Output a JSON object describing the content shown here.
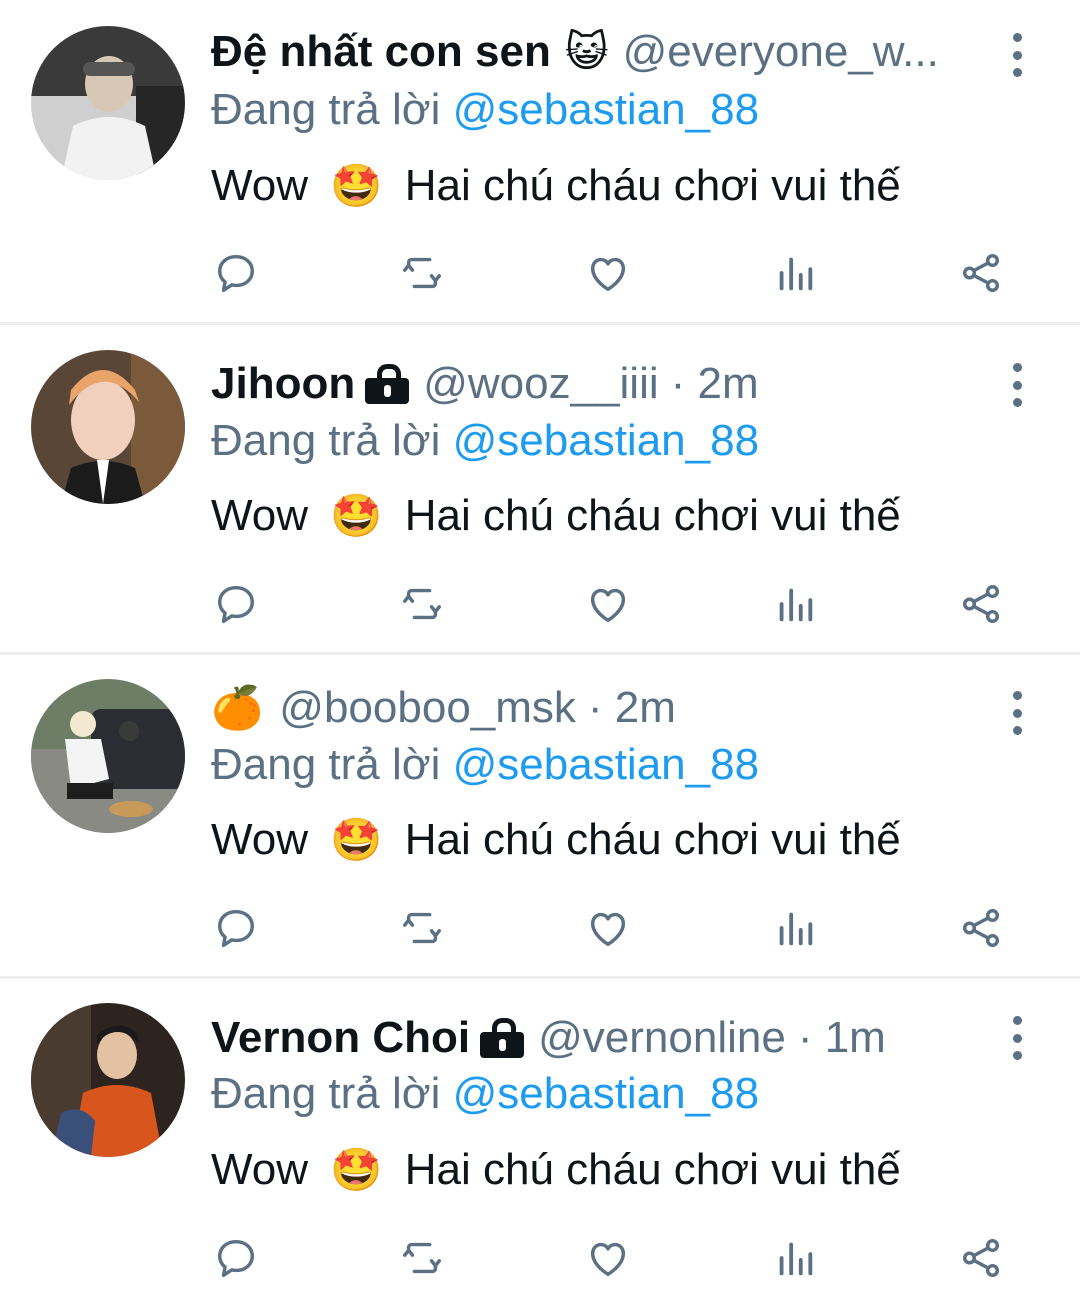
{
  "tweets": [
    {
      "display_name": "Đệ nhất con sen",
      "name_emoji": "😺",
      "handle": "@everyone_w...",
      "time": "",
      "replying_prefix": "Đang trả lời",
      "replying_to": "@sebastian_88",
      "text_before": "Wow",
      "text_emoji": "🤩",
      "text_after": "Hai chú cháu chơi vui thế",
      "locked": false,
      "avatar_palette": [
        "#3a3a3a",
        "#f2f2f2",
        "#d7c8b5"
      ]
    },
    {
      "display_name": "Jihoon",
      "name_emoji": "",
      "handle": "@wooz__iiii",
      "time": "· 2m",
      "replying_prefix": "Đang trả lời",
      "replying_to": "@sebastian_88",
      "text_before": "Wow",
      "text_emoji": "🤩",
      "text_after": "Hai chú cháu chơi vui thế",
      "locked": true,
      "avatar_palette": [
        "#5a4636",
        "#e9a46a",
        "#1b1b1b"
      ]
    },
    {
      "display_name": "",
      "name_emoji": "🍊",
      "handle": "@booboo_msk",
      "time": "· 2m",
      "replying_prefix": "Đang trả lời",
      "replying_to": "@sebastian_88",
      "text_before": "Wow",
      "text_emoji": "🤩",
      "text_after": "Hai chú cháu chơi vui thế",
      "locked": false,
      "avatar_palette": [
        "#6d7d66",
        "#2b2d33",
        "#c79a5a"
      ]
    },
    {
      "display_name": "Vernon Choi",
      "name_emoji": "",
      "handle": "@vernonline",
      "time": "· 1m",
      "replying_prefix": "Đang trả lời",
      "replying_to": "@sebastian_88",
      "text_before": "Wow",
      "text_emoji": "🤩",
      "text_after": "Hai chú cháu chơi vui thế",
      "locked": true,
      "avatar_palette": [
        "#2d2420",
        "#d8561e",
        "#3a4f7a"
      ]
    }
  ],
  "actions": [
    "reply-icon",
    "retweet-icon",
    "like-icon",
    "analytics-icon",
    "share-icon"
  ],
  "colors": {
    "text": "#0f1419",
    "secondary": "#5b7083",
    "mention": "#1d9bf0",
    "divider": "#eceef0"
  }
}
